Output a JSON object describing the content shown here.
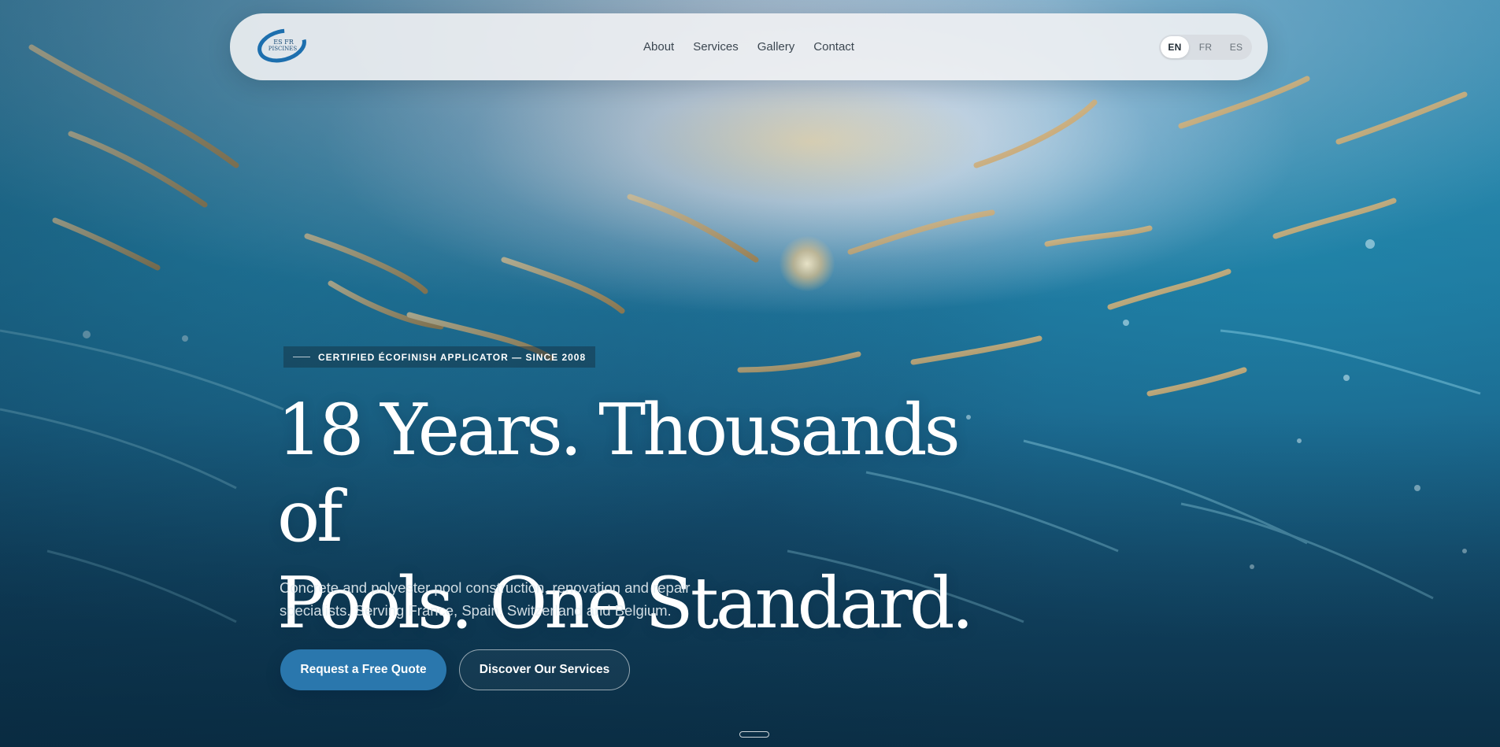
{
  "brand": {
    "logo_text_top": "ES FR",
    "logo_text_bottom": "PISCINES"
  },
  "nav": {
    "links": [
      {
        "label": "About"
      },
      {
        "label": "Services"
      },
      {
        "label": "Gallery"
      },
      {
        "label": "Contact"
      }
    ],
    "languages": [
      {
        "code": "EN",
        "active": true
      },
      {
        "code": "FR",
        "active": false
      },
      {
        "code": "ES",
        "active": false
      }
    ]
  },
  "hero": {
    "badge": "CERTIFIED ÉCOFINISH APPLICATOR — SINCE 2008",
    "headline_line1": "18 Years. Thousands of",
    "headline_line2": "Pools. One Standard.",
    "subtitle_line1": "Concrete and polyester pool construction, renovation and repair",
    "subtitle_line2": "specialists. Serving France, Spain, Switzerland and Belgium.",
    "primary_cta": "Request a Free Quote",
    "secondary_cta": "Discover Our Services"
  },
  "colors": {
    "accent": "#2a77ad",
    "nav_bg": "#f0f1f3",
    "water_dark": "#0f3d58"
  },
  "icons": {
    "logo": "swoosh-logo-icon",
    "scroll": "scroll-indicator-icon"
  }
}
